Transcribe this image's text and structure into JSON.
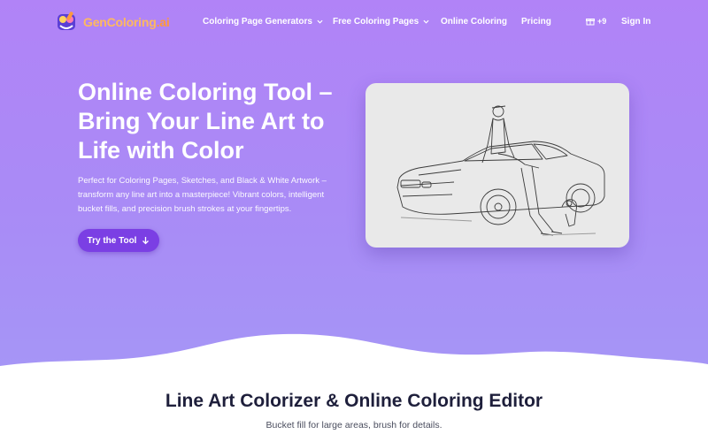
{
  "brand": {
    "name_main": "GenColoring",
    "name_suffix": ".ai"
  },
  "nav": {
    "items": [
      {
        "label": "Coloring Page Generators",
        "has_dropdown": true
      },
      {
        "label": "Free Coloring Pages",
        "has_dropdown": true
      },
      {
        "label": "Online Coloring",
        "has_dropdown": false
      },
      {
        "label": "Pricing",
        "has_dropdown": false
      }
    ],
    "gift_count": "+9",
    "sign_in": "Sign In"
  },
  "hero": {
    "title": "Online Coloring Tool – Bring Your Line Art to Life with Color",
    "description": "Perfect for Coloring Pages, Sketches, and Black & White Artwork – transform any line art into a masterpiece! Vibrant colors, intelligent bucket fills, and precision brush strokes at your fingertips.",
    "cta_label": "Try the Tool"
  },
  "section": {
    "title": "Line Art Colorizer & Online Coloring Editor",
    "subtitle": "Bucket fill for large areas, brush for details."
  },
  "colors": {
    "hero_gradient_top": "#b183f7",
    "hero_gradient_bottom": "#a596f6",
    "cta_background": "#7b3fe4",
    "logo_text": "#ffb95e",
    "heading_dark": "#1e1f3b"
  },
  "icons": [
    "logo-icon",
    "chevron-down-icon",
    "gift-icon",
    "arrow-down-icon"
  ]
}
